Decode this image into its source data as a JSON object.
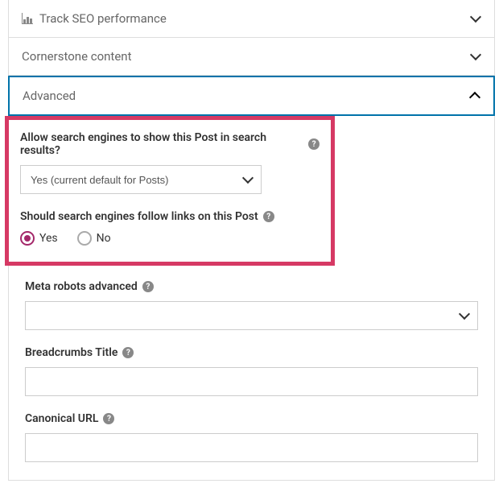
{
  "sections": {
    "seo": {
      "title": "Track SEO performance"
    },
    "cornerstone": {
      "title": "Cornerstone content"
    },
    "advanced": {
      "title": "Advanced"
    }
  },
  "advanced": {
    "allow_search_label": "Allow search engines to show this Post in search results?",
    "allow_search_value": "Yes (current default for Posts)",
    "follow_links_label": "Should search engines follow links on this Post",
    "follow_links_yes": "Yes",
    "follow_links_no": "No",
    "meta_robots_label": "Meta robots advanced",
    "meta_robots_value": "",
    "breadcrumbs_label": "Breadcrumbs Title",
    "breadcrumbs_value": "",
    "canonical_label": "Canonical URL",
    "canonical_value": ""
  }
}
